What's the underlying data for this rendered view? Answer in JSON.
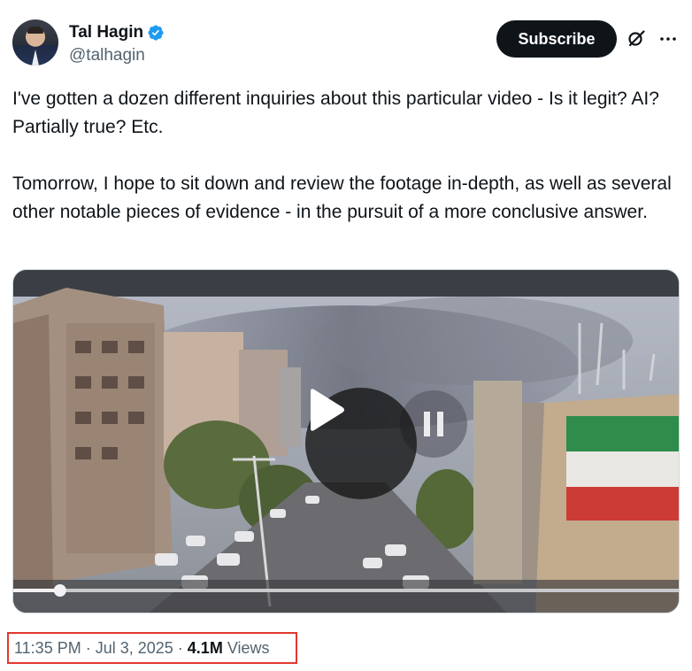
{
  "author": {
    "name": "Tal Hagin",
    "handle": "@talhagin",
    "verified": true,
    "badge_color": "#1d9bf0"
  },
  "actions": {
    "subscribe_label": "Subscribe",
    "grok_icon": "grok-icon",
    "more_icon": "more-icon"
  },
  "tweet": {
    "paragraphs": [
      "I've gotten a dozen different inquiries about this particular video - Is it legit? AI? Partially true? Etc.",
      "Tomorrow, I hope to sit down and review the footage in-depth, as well as several other notable pieces of evidence - in the pursuit of a more conclusive answer."
    ]
  },
  "media": {
    "type": "video",
    "state": "paused",
    "play_icon": "play-icon",
    "progress": 0.07
  },
  "meta": {
    "time": "11:35 PM",
    "separator": "·",
    "date": "Jul 3, 2025",
    "views_count": "4.1M",
    "views_label": "Views",
    "highlight_color": "#e0382f"
  }
}
